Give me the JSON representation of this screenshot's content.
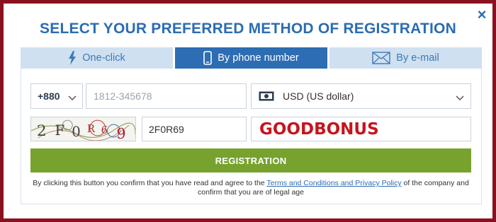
{
  "modal": {
    "title": "SELECT YOUR PREFERRED METHOD OF REGISTRATION",
    "close_icon": "close-icon"
  },
  "tabs": [
    {
      "label": "One-click",
      "icon": "lightning-icon",
      "active": false
    },
    {
      "label": "By phone number",
      "icon": "phone-icon",
      "active": true
    },
    {
      "label": "By e-mail",
      "icon": "envelope-icon",
      "active": false
    }
  ],
  "form": {
    "country_code": "+880",
    "phone_placeholder": "1812-345678",
    "currency": "USD (US dollar)",
    "captcha_text": "2F0R69",
    "captcha_display": [
      "2",
      "F",
      "0",
      "R",
      "6",
      "9"
    ],
    "captcha_input_value": "2F0R69",
    "promo_code": "GOODBONUS",
    "register_label": "REGISTRATION"
  },
  "legal": {
    "before": "By clicking this button you confirm that you have read and agree to the ",
    "link": "Terms and Conditions and Privacy Policy",
    "after": " of the company and confirm that you are of legal age"
  },
  "colors": {
    "background": "#8a1220",
    "accent_blue": "#2d6db3",
    "tab_inactive": "#cfe0f1",
    "button_green": "#77a22e",
    "promo_red": "#c5151d"
  }
}
